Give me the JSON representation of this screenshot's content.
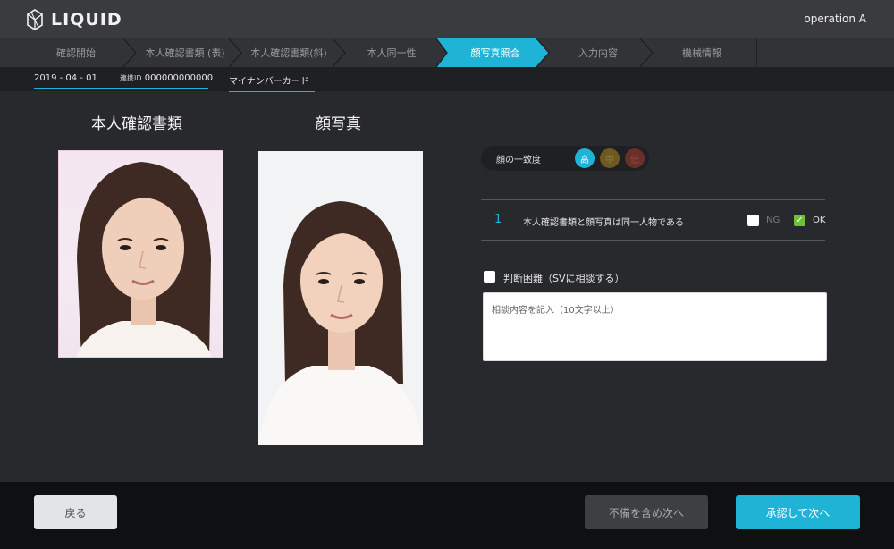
{
  "app": {
    "brand": "LIQUID",
    "operator": "operation A"
  },
  "steps": [
    {
      "label": "確認開始",
      "active": false
    },
    {
      "label": "本人確認書類 (表)",
      "active": false
    },
    {
      "label": "本人確認書類(斜)",
      "active": false
    },
    {
      "label": "本人同一性",
      "active": false
    },
    {
      "label": "顔写真照合",
      "active": true
    },
    {
      "label": "入力内容",
      "active": false
    },
    {
      "label": "機械情報",
      "active": false
    }
  ],
  "info": {
    "date": "2019 - 04 - 01",
    "id_label": "連携ID",
    "id_value": "000000000000",
    "document": "マイナンバーカード"
  },
  "main": {
    "id_doc_title": "本人確認書類",
    "face_photo_title": "顔写真"
  },
  "match": {
    "label": "顔の一致度",
    "levels": [
      "高",
      "中",
      "低"
    ],
    "selected": "高"
  },
  "checks": [
    {
      "number": "1",
      "text": "本人確認書類と顔写真は同一人物である",
      "ng_label": "NG",
      "ok_label": "OK",
      "value": "OK"
    }
  ],
  "difficult": {
    "label": "判断困難（SVに相談する）",
    "checked": false,
    "placeholder": "相談内容を記入（10文字以上）"
  },
  "footer": {
    "back": "戻る",
    "incomplete_next": "不備を含め次へ",
    "approve_next": "承認して次へ"
  },
  "colors": {
    "accent": "#1fb3d6",
    "ok_green": "#6fbf3b",
    "background": "#28292c"
  }
}
